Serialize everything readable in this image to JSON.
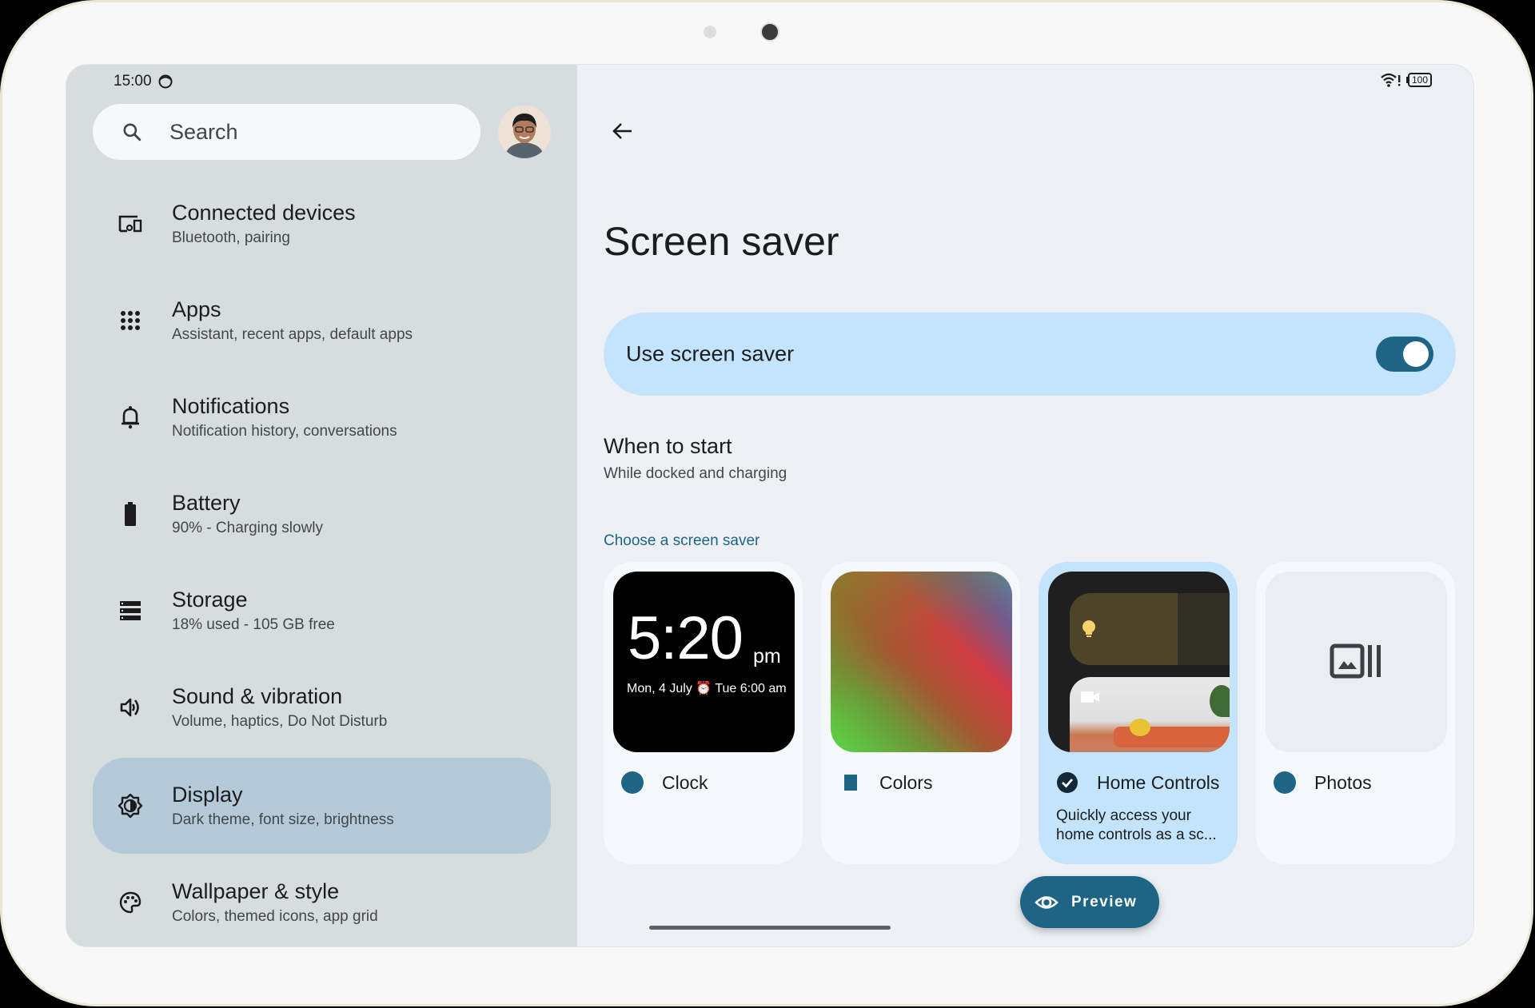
{
  "status_bar": {
    "time": "15:00",
    "battery_level": "100",
    "icons": [
      "face-status-icon",
      "wifi-alert-icon",
      "battery-icon"
    ]
  },
  "sidebar": {
    "search": {
      "placeholder": "Search"
    },
    "avatar": "profile-avatar",
    "items": [
      {
        "title": "Connected devices",
        "subtitle": "Bluetooth, pairing",
        "icon": "devices-icon"
      },
      {
        "title": "Apps",
        "subtitle": "Assistant, recent apps, default apps",
        "icon": "apps-grid-icon"
      },
      {
        "title": "Notifications",
        "subtitle": "Notification history, conversations",
        "icon": "bell-icon"
      },
      {
        "title": "Battery",
        "subtitle": "90% - Charging slowly",
        "icon": "battery-icon"
      },
      {
        "title": "Storage",
        "subtitle": "18% used - 105 GB free",
        "icon": "storage-icon"
      },
      {
        "title": "Sound & vibration",
        "subtitle": "Volume, haptics, Do Not Disturb",
        "icon": "volume-icon"
      },
      {
        "title": "Display",
        "subtitle": "Dark theme, font size, brightness",
        "icon": "brightness-icon",
        "active": true
      },
      {
        "title": "Wallpaper & style",
        "subtitle": "Colors, themed icons, app grid",
        "icon": "palette-icon"
      }
    ]
  },
  "main": {
    "title": "Screen saver",
    "use_screen_saver": {
      "label": "Use screen saver",
      "enabled": true
    },
    "when_to_start": {
      "title": "When to start",
      "value": "While docked and charging"
    },
    "choose_label": "Choose a screen saver",
    "options": [
      {
        "name": "Clock",
        "selected": false,
        "preview": {
          "time": "5:20",
          "ampm": "pm",
          "date": "Mon, 4 July",
          "alarm": "Tue 6:00 am"
        }
      },
      {
        "name": "Colors",
        "selected": false
      },
      {
        "name": "Home Controls",
        "selected": true,
        "description": "Quickly access your home controls as a sc..."
      },
      {
        "name": "Photos",
        "selected": false
      }
    ],
    "preview_button": "Preview"
  },
  "colors": {
    "accent": "#1e6585",
    "toggle_row_bg": "#c3e4fc",
    "sidebar_bg": "#d7dcdf",
    "active_item_bg": "#b4cad9",
    "main_bg": "#edf0f5"
  }
}
